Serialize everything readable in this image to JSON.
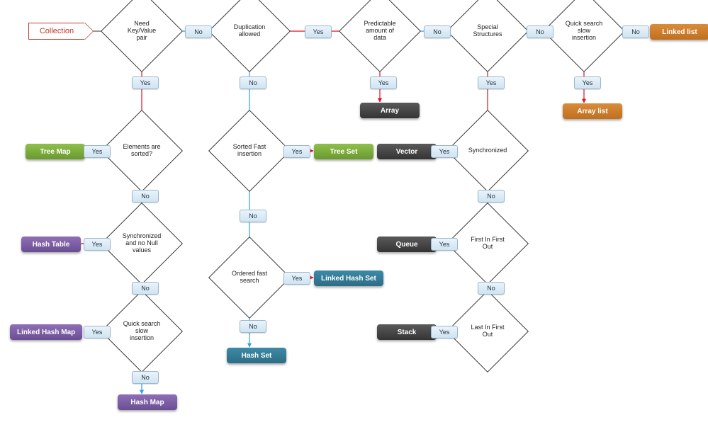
{
  "start": {
    "label": "Collection"
  },
  "decisions": {
    "d1": "Need Key/Value pair",
    "d2": "Duplication allowed",
    "d3": "Predictable amount of data",
    "d4": "Special Structures",
    "d5": "Quick search slow insertion",
    "d6": "Elements are sorted?",
    "d7": "Sorted Fast insertion",
    "d8": "Synchronized and no Null values",
    "d9": "Ordered fast search",
    "d10": "Quick search slow insertion",
    "d11": "Synchronized",
    "d12": "First In First Out",
    "d13": "Last In First Out"
  },
  "labels": {
    "yes": "Yes",
    "no": "No"
  },
  "results": {
    "tree_map": "Tree Map",
    "hash_table": "Hash Table",
    "linked_hash_map": "Linked Hash Map",
    "hash_map": "Hash Map",
    "tree_set": "Tree Set",
    "linked_hash_set": "Linked Hash Set",
    "hash_set": "Hash Set",
    "array": "Array",
    "vector": "Vector",
    "queue": "Queue",
    "stack": "Stack",
    "linked_list": "Linked list",
    "array_list": "Array list"
  },
  "chart_data": {
    "type": "flowchart",
    "start": "Collection",
    "edges": [
      {
        "from": "Collection",
        "to": "Need Key/Value pair"
      },
      {
        "from": "Need Key/Value pair",
        "answer": "No",
        "to": "Duplication allowed"
      },
      {
        "from": "Need Key/Value pair",
        "answer": "Yes",
        "to": "Elements are sorted?"
      },
      {
        "from": "Duplication allowed",
        "answer": "Yes",
        "to": "Predictable amount of data"
      },
      {
        "from": "Duplication allowed",
        "answer": "No",
        "to": "Sorted Fast insertion"
      },
      {
        "from": "Predictable amount of data",
        "answer": "Yes",
        "to": "Array"
      },
      {
        "from": "Predictable amount of data",
        "answer": "No",
        "to": "Special Structures"
      },
      {
        "from": "Special Structures",
        "answer": "No",
        "to": "Quick search slow insertion (right)"
      },
      {
        "from": "Special Structures",
        "answer": "Yes",
        "to": "Synchronized"
      },
      {
        "from": "Quick search slow insertion (right)",
        "answer": "No",
        "to": "Linked list"
      },
      {
        "from": "Quick search slow insertion (right)",
        "answer": "Yes",
        "to": "Array list"
      },
      {
        "from": "Elements are sorted?",
        "answer": "Yes",
        "to": "Tree Map"
      },
      {
        "from": "Elements are sorted?",
        "answer": "No",
        "to": "Synchronized and no Null values"
      },
      {
        "from": "Synchronized and no Null values",
        "answer": "Yes",
        "to": "Hash Table"
      },
      {
        "from": "Synchronized and no Null values",
        "answer": "No",
        "to": "Quick search slow insertion (left)"
      },
      {
        "from": "Quick search slow insertion (left)",
        "answer": "Yes",
        "to": "Linked Hash Map"
      },
      {
        "from": "Quick search slow insertion (left)",
        "answer": "No",
        "to": "Hash Map"
      },
      {
        "from": "Sorted Fast insertion",
        "answer": "Yes",
        "to": "Tree Set"
      },
      {
        "from": "Sorted Fast insertion",
        "answer": "No",
        "to": "Ordered fast search"
      },
      {
        "from": "Ordered fast search",
        "answer": "Yes",
        "to": "Linked Hash Set"
      },
      {
        "from": "Ordered fast search",
        "answer": "No",
        "to": "Hash Set"
      },
      {
        "from": "Synchronized",
        "answer": "Yes",
        "to": "Vector"
      },
      {
        "from": "Synchronized",
        "answer": "No",
        "to": "First In First Out"
      },
      {
        "from": "First In First Out",
        "answer": "Yes",
        "to": "Queue"
      },
      {
        "from": "First In First Out",
        "answer": "No",
        "to": "Last In First Out"
      },
      {
        "from": "Last In First Out",
        "answer": "Yes",
        "to": "Stack"
      }
    ]
  }
}
